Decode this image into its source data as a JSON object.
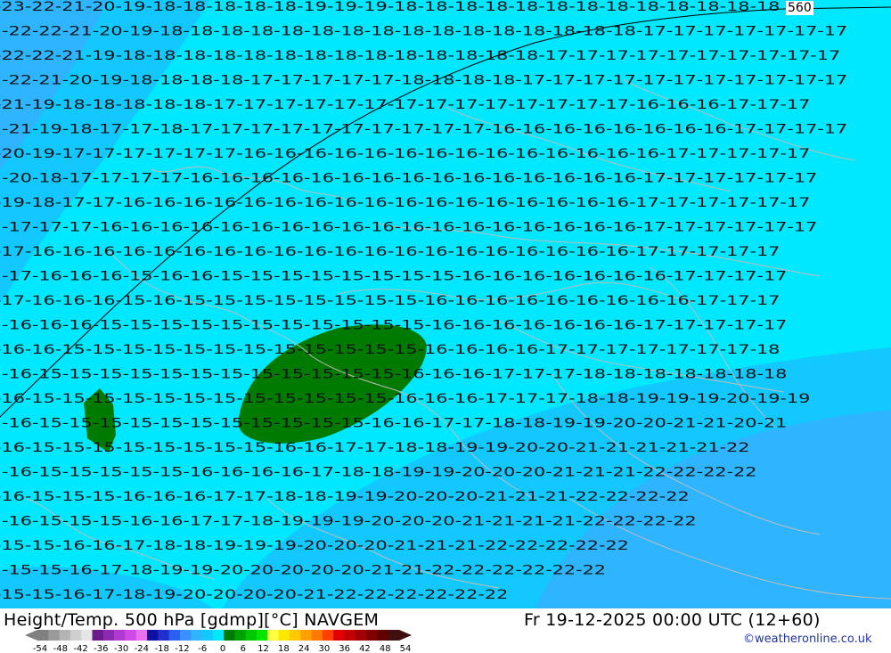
{
  "map": {
    "contour_label": "560",
    "colors": {
      "deep_blue": "#3a9cff",
      "mid_blue": "#2fb4ff",
      "light_blue": "#12c8ff",
      "cyan": "#00e8ff",
      "green": "#007a00",
      "border": "#bdbdbd",
      "contour": "#000000"
    },
    "rows": [
      "-23-22-21-20-19-18-18-18-18-18-19-19-19-18-18-18-18-18-18-18-18-18-18-18-18-18",
      "-22-22-21-20-19-18-18-18-18-18-18-18-18-18-18-18-18-18-18-18-18-17-17-17-17-17-17-17",
      "-22-22-21-19-18-18-18-18-18-18-18-18-18-18-18-18-18-18-17-17-17-17-17-17-17-17-17-17",
      "-22-21-20-19-18-18-18-18-17-17-17-17-17-18-18-18-18-17-17-17-17-17-17-17-17-17-17-17",
      "-21-19-18-18-18-18-18-17-17-17-17-17-17-17-17-17-17-17-17-17-17-16-16-16-17-17-17",
      "-21-19-18-17-17-18-17-17-17-17-17-17-17-17-17-17-16-16-16-16-16-16-16-16-17-17-17-17",
      "-20-19-17-17-17-17-17-17-16-16-16-16-16-16-16-16-16-16-16-16-16-16-17-17-17-17-17",
      "-20-18-17-17-17-17-16-16-16-16-16-16-16-16-16-16-16-16-16-16-16-17-17-17-17-17-17",
      "-19-18-17-17-16-16-16-16-16-16-16-16-16-16-16-16-16-16-16-16-16-17-17-17-17-17-17",
      "-17-17-17-16-16-16-16-16-16-16-16-16-16-16-16-16-16-16-16-16-16-17-17-17-17-17-17",
      "-17-16-16-16-16-16-16-16-16-16-16-16-16-16-16-16-16-16-16-16-16-17-17-17-17-17",
      "-17-16-16-16-15-16-16-15-15-15-15-15-15-15-15-16-16-16-16-16-16-16-17-17-17-17",
      "-17-16-16-16-15-16-15-15-15-15-15-15-15-15-16-16-16-16-16-16-16-16-16-17-17-17",
      "-16-16-16-15-15-15-15-15-15-15-15-15-15-15-16-16-16-16-16-16-16-17-17-17-17-17",
      "-16-16-15-15-15-15-15-15-15-15-15-15-15-15-16-16-16-16-17-17-17-17-17-17-17-18",
      "-16-15-15-15-15-15-15-15-15-15-15-15-15-16-16-16-17-17-17-18-18-18-18-18-18-18",
      "-16-15-15-15-15-15-15-15-15-15-15-15-15-16-16-16-17-17-17-18-18-19-19-19-20-19-19",
      "-16-15-15-15-15-15-15-15-15-15-15-15-16-16-17-17-18-18-19-19-20-20-21-21-20-21",
      "-16-15-15-15-15-15-15-15-15-16-16-17-17-18-18-19-19-20-20-21-21-21-21-21-22",
      "-16-15-15-15-15-15-16-16-16-16-17-18-18-19-19-20-20-20-21-21-21-22-22-22-22",
      "-16-15-15-15-16-16-16-17-17-18-18-19-19-20-20-20-21-21-21-22-22-22-22",
      "-16-15-15-15-16-16-17-17-18-19-19-19-20-20-20-21-21-21-21-22-22-22-22",
      "-15-15-16-16-17-18-18-19-19-19-20-20-20-21-21-21-22-22-22-22-22",
      "-15-15-16-17-18-19-19-20-20-20-20-20-21-21-22-22-22-22-22-22",
      "-15-15-16-17-18-19-20-20-20-20-21-22-22-22-22-22-22"
    ]
  },
  "footer": {
    "title": "Height/Temp. 500 hPa [gdmp][°C] NAVGEM",
    "time": "Fr 19-12-2025 00:00 UTC (12+60)",
    "credit": "©weatheronline.co.uk"
  },
  "legend": {
    "ticks": [
      "-54",
      "-48",
      "-42",
      "-36",
      "-30",
      "-24",
      "-18",
      "-12",
      "-6",
      "0",
      "6",
      "12",
      "18",
      "24",
      "30",
      "36",
      "42",
      "48",
      "54"
    ],
    "colors": [
      "#808080",
      "#9a9a9a",
      "#b4b4b4",
      "#cfcfcf",
      "#e6e6e6",
      "#6a1a8a",
      "#8a2ab0",
      "#b03ad0",
      "#d04ae8",
      "#e870f0",
      "#1010a0",
      "#2030d0",
      "#2a60f0",
      "#3a90ff",
      "#2fb4ff",
      "#12c8ff",
      "#00e8ff",
      "#007a00",
      "#00a000",
      "#00c800",
      "#00e600",
      "#ffff40",
      "#ffe600",
      "#ffc800",
      "#ffa000",
      "#ff7800",
      "#ff4000",
      "#e00000",
      "#c00000",
      "#a00000",
      "#800000",
      "#600000",
      "#401010"
    ]
  }
}
